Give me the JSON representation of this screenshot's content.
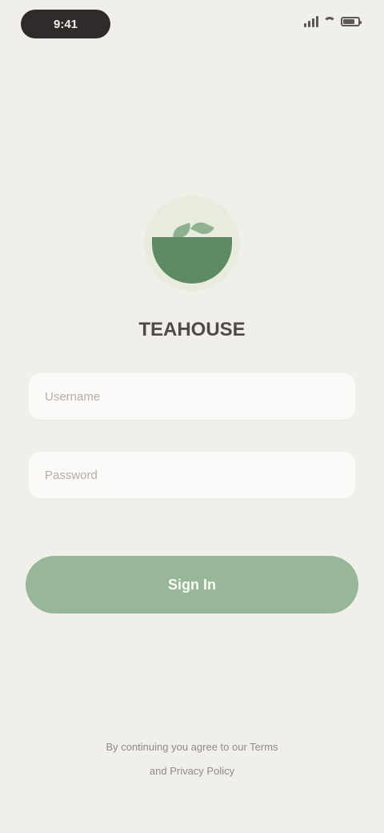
{
  "status_bar": {
    "time": "9:41",
    "battery_level": 0.8,
    "icons": [
      "cellular-signal-icon",
      "wifi-icon",
      "battery-icon"
    ]
  },
  "app": {
    "name": "TEAHOUSE",
    "logo_icon": "tea-bowl-icon"
  },
  "form": {
    "username_placeholder": "Username",
    "password_placeholder": "Password",
    "submit_label": "Sign In"
  },
  "footer": {
    "line1": "By continuing you agree to our Terms",
    "line2": "and Privacy Policy"
  },
  "colors": {
    "background": "#f1efea",
    "accent": "#98b698",
    "logo_green": "#5f8a63"
  }
}
